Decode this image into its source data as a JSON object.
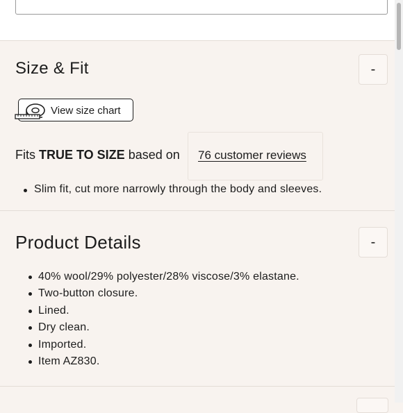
{
  "size_fit": {
    "title": "Size & Fit",
    "toggle_symbol": "-",
    "size_chart_label": "View size chart",
    "size_chart_icon": "measuring-tape-icon",
    "fits_prefix": "Fits ",
    "fits_emphasis": "TRUE TO SIZE",
    "fits_suffix": " based on",
    "reviews_link": "76 customer reviews",
    "bullets": [
      "Slim fit, cut more narrowly through the body and sleeves."
    ]
  },
  "product_details": {
    "title": "Product Details",
    "toggle_symbol": "-",
    "bullets": [
      "40% wool/29% polyester/28% viscose/3% elastane.",
      "Two-button closure.",
      "Lined.",
      "Dry clean.",
      "Imported.",
      "Item AZ830."
    ]
  },
  "colors": {
    "background": "#f8f3ef",
    "text": "#1c1c1c",
    "divider": "#e3dcd6"
  }
}
